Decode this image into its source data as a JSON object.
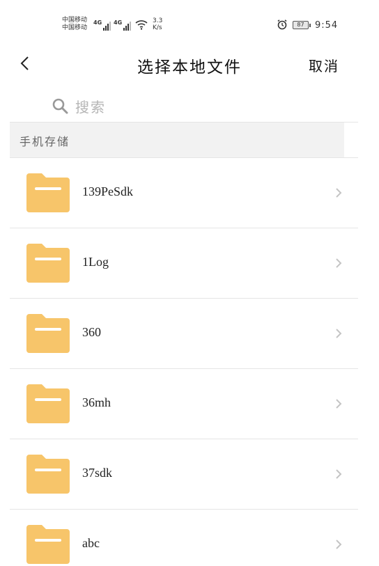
{
  "status_bar": {
    "carrier_1": "中国移动",
    "carrier_2": "中国移动",
    "network_tag": "4G",
    "speed_value": "3.3",
    "speed_unit": "K/s",
    "battery": "87",
    "time": "9:54"
  },
  "nav": {
    "title": "选择本地文件",
    "cancel_label": "取消"
  },
  "search": {
    "placeholder": "搜索"
  },
  "section": {
    "label": "手机存储"
  },
  "folders": [
    {
      "name": "139PeSdk"
    },
    {
      "name": "1Log"
    },
    {
      "name": "360"
    },
    {
      "name": "36mh"
    },
    {
      "name": "37sdk"
    },
    {
      "name": "abc"
    }
  ],
  "colors": {
    "folder": "#f7c56a",
    "folder_stripe": "#ffffff",
    "divider": "#e5e5e5",
    "section_bg": "#f2f2f2",
    "chevron": "#c4c4c4"
  }
}
